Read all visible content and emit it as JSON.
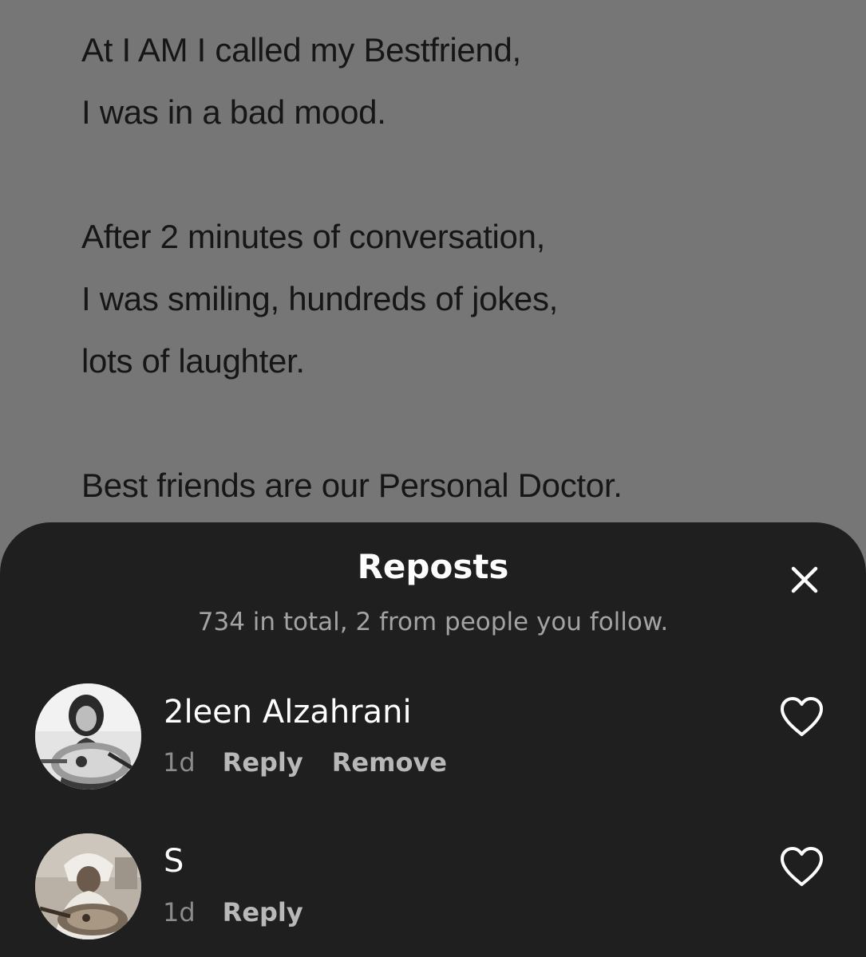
{
  "post": {
    "lines": [
      "At I AM I called my Bestfriend,",
      "I was in a bad mood.",
      "After 2 minutes of conversation,",
      "I was smiling, hundreds of jokes,",
      "lots of laughter.",
      "Best friends are our Personal Doctor."
    ]
  },
  "sheet": {
    "title": "Reposts",
    "subtitle": "734 in total, 2 from people you follow.",
    "close_icon": "close-icon"
  },
  "reposts": [
    {
      "name": "2leen Alzahrani",
      "time": "1d",
      "reply_label": "Reply",
      "remove_label": "Remove",
      "icon": "heart-outline-icon"
    },
    {
      "name": "S",
      "time": "1d",
      "reply_label": "Reply",
      "icon": "heart-outline-icon"
    }
  ],
  "colors": {
    "background": "#767676",
    "sheet": "#1f1f1f",
    "title": "#ffffff",
    "subtitle": "#a3a3a3",
    "meta_time": "#8c8c8c",
    "meta_action": "#b8b8b8"
  }
}
